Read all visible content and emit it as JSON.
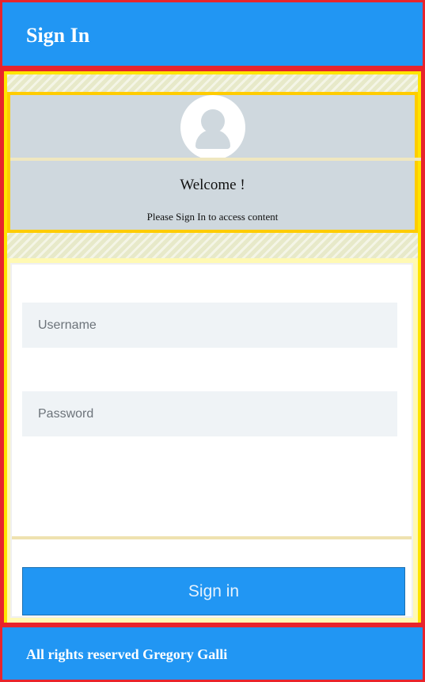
{
  "header": {
    "title": "Sign In"
  },
  "profile": {
    "welcome": "Welcome !",
    "subtitle": "Please Sign In to access content"
  },
  "form": {
    "username_placeholder": "Username",
    "password_placeholder": "Password",
    "submit_label": "Sign in"
  },
  "footer": {
    "text": "All rights reserved Gregory Galli"
  },
  "colors": {
    "header_bg": "#2196f3",
    "frame": "#e8242c",
    "panel_border": "#ffe500",
    "profile_bg": "#cfd8de",
    "input_bg": "#eff3f6"
  },
  "icons": {
    "avatar": "user-avatar-icon"
  }
}
